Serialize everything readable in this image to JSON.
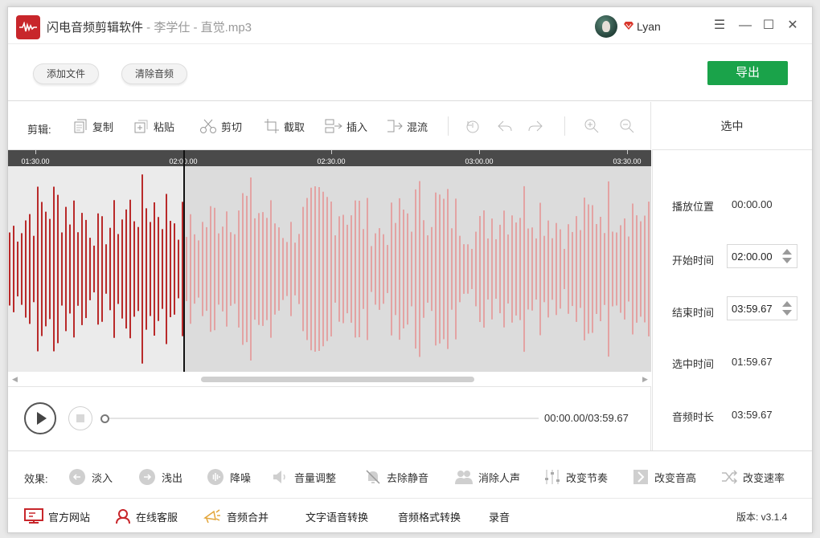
{
  "titlebar": {
    "app_name": "闪电音频剪辑软件",
    "file_info": " - 李学仕 - 直觉.mp3",
    "user": "Lyan",
    "minimize_glyph": "☰",
    "min_glyph": "—",
    "max_glyph": "☐",
    "close_glyph": "✕"
  },
  "topbar": {
    "add_file": "添加文件",
    "clear_audio": "清除音频",
    "export": "导出"
  },
  "editbar": {
    "label": "剪辑:",
    "copy": "复制",
    "paste": "粘贴",
    "cut": "剪切",
    "crop": "截取",
    "insert": "插入",
    "mix": "混流"
  },
  "ruler": {
    "ticks": [
      "01:30.00",
      "02:00.00",
      "02:30.00",
      "03:00.00",
      "03:30.00"
    ]
  },
  "side": {
    "header": "选中",
    "play_pos_label": "播放位置",
    "play_pos": "00:00.00",
    "start_label": "开始时间",
    "start": "02:00.00",
    "end_label": "结束时间",
    "end": "03:59.67",
    "sel_label": "选中时间",
    "sel": "01:59.67",
    "dur_label": "音频时长",
    "dur": "03:59.67"
  },
  "player": {
    "time": "00:00.00/03:59.67",
    "progress": 0
  },
  "effects": {
    "label": "效果:",
    "fade_in": "淡入",
    "fade_out": "浅出",
    "denoise": "降噪",
    "volume": "音量调整",
    "remove_silence": "去除静音",
    "remove_vocal": "消除人声",
    "tempo": "改变节奏",
    "pitch": "改变音高",
    "speed": "改变速率"
  },
  "bottom": {
    "website": "官方网站",
    "support": "在线客服",
    "merge": "音频合并",
    "tts": "文字语音转换",
    "convert": "音频格式转换",
    "record": "录音",
    "version": "版本: v3.1.4"
  },
  "colors": {
    "accent": "#1aa34a",
    "brand": "#c8262b",
    "wave_selected": "#b92a2a",
    "wave_unselected": "#e3a3a3"
  }
}
